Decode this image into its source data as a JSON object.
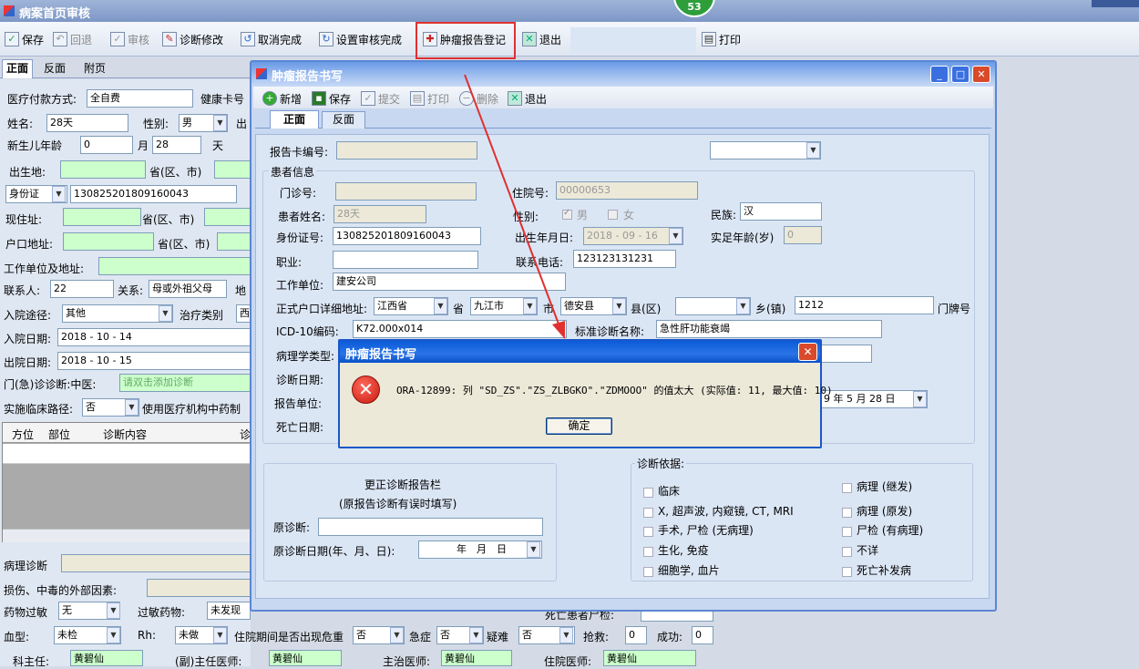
{
  "main_window": {
    "title": "病案首页审核",
    "badge": "53"
  },
  "toolbar": {
    "save": "保存",
    "rollback": "回退",
    "audit": "审核",
    "diag_edit": "诊断修改",
    "cancel_done": "取消完成",
    "set_done": "设置审核完成",
    "tumor_register": "肿瘤报告登记",
    "exit": "退出",
    "print": "打印"
  },
  "main_tabs": [
    "正面",
    "反面",
    "附页"
  ],
  "main_form": {
    "payment_label": "医疗付款方式:",
    "payment": "全自费",
    "health_card_label": "健康卡号",
    "name_label": "姓名:",
    "name": "28天",
    "gender_label": "性别:",
    "gender": "男",
    "birth_short": "出",
    "newborn_label": "新生儿年龄",
    "newborn_year": "0",
    "month": "月",
    "newborn_month": "28",
    "day": "天",
    "birthplace_label": "出生地:",
    "province_label": "省(区、市)",
    "id_type": "身份证",
    "id_number": "130825201809160043",
    "address_label": "现住址:",
    "hukou_label": "户口地址:",
    "work_label": "工作单位及地址:",
    "contact_label": "联系人:",
    "contact": "22",
    "relation_label": "关系:",
    "relation": "母或外祖父母",
    "land": "地",
    "admit_route_label": "入院途径:",
    "admit_route": "其他",
    "treat_type_label": "治疗类别",
    "treat_type": "西",
    "admit_date_label": "入院日期:",
    "admit_date": "2018 - 10 - 14",
    "discharge_date_label": "出院日期:",
    "discharge_date": "2018 - 10 - 15",
    "er_diag_label": "门(急)诊诊断:中医:",
    "er_diag_placeholder": "请双击添加诊断",
    "clinical_path_label": "实施临床路径:",
    "clinical_path": "否",
    "use_drug_label": "使用医疗机构中药制",
    "diag_table_headers": [
      "方位",
      "部位",
      "诊断内容",
      "诊"
    ],
    "pathology_label": "病理诊断",
    "injury_label": "损伤、中毒的外部因素:",
    "allergy_label": "药物过敏",
    "allergy": "无",
    "allergy_drug_label": "过敏药物:",
    "allergy_drug": "未发现",
    "blood_label": "血型:",
    "blood": "未检",
    "rh_label": "Rh:",
    "rh": "未做",
    "danger_label": "住院期间是否出现危重",
    "danger": "否",
    "acute_label": "急症",
    "acute": "否",
    "hard_label": "疑难",
    "hard": "否",
    "rescue_label": "抢救:",
    "rescue": "0",
    "success_label": "成功:",
    "success": "0",
    "director_label": "科主任:",
    "director": "黄碧仙",
    "vice_label": "(副)主任医师:",
    "vice": "黄碧仙",
    "attending_label": "主治医师:",
    "attending": "黄碧仙",
    "resident_label": "住院医师:",
    "resident": "黄碧仙",
    "death_age_label": "死亡患者尸检:"
  },
  "tumor_window": {
    "title": "肿瘤报告书写",
    "toolbar": {
      "add": "新增",
      "save": "保存",
      "submit": "提交",
      "print": "打印",
      "delete": "删除",
      "exit": "退出"
    },
    "tabs": [
      "正面",
      "反面"
    ],
    "card_no_label": "报告卡编号:",
    "patient_group": "患者信息",
    "outpatient_label": "门诊号:",
    "inpatient_label": "住院号:",
    "inpatient": "00000653",
    "pname_label": "患者姓名:",
    "pname": "28天",
    "gender_label": "性别:",
    "male": "男",
    "female": "女",
    "nation_label": "民族:",
    "nation": "汉",
    "idcard_label": "身份证号:",
    "idcard": "130825201809160043",
    "birthday_label": "出生年月日:",
    "birthday": "2018 - 09 - 16",
    "age_label": "实足年龄(岁)",
    "age": "0",
    "job_label": "职业:",
    "phone_label": "联系电话:",
    "phone": "123123131231",
    "work_label": "工作单位:",
    "work": "建安公司",
    "hukou_label": "正式户口详细地址:",
    "province": "江西省",
    "province_unit": "省",
    "city": "九江市",
    "city_unit": "市",
    "county": "德安县",
    "county_unit": "县(区)",
    "town_unit": "乡(镇)",
    "street": "1212",
    "door_label": "门牌号",
    "icd_label": "ICD-10编码:",
    "icd": "K72.000x014",
    "std_diag_label": "标准诊断名称:",
    "std_diag": "急性肝功能衰竭",
    "pathology_type_label": "病理学类型:",
    "diag_date_label": "诊断日期:",
    "report_unit_label": "报告单位:",
    "report_date": "9 年 5 月 28 日",
    "death_date_label": "死亡日期:",
    "correction_title": "更正诊断报告栏",
    "correction_sub": "(原报告诊断有误时填写)",
    "orig_diag_label": "原诊断:",
    "orig_date_label": "原诊断日期(年、月、日):",
    "orig_date": "年　月　日",
    "basis_label": "诊断依据:",
    "basis_left": [
      "临床",
      "X, 超声波, 内窥镜, CT, MRI",
      "手术, 尸检 (无病理)",
      "生化, 免疫",
      "细胞学, 血片"
    ],
    "basis_right": [
      "病理 (继发)",
      "病理 (原发)",
      "尸检 (有病理)",
      "不详",
      "死亡补发病"
    ]
  },
  "error_dialog": {
    "title": "肿瘤报告书写",
    "message": "ORA-12899: 列 \"SD_ZS\".\"ZS_ZLBGKO\".\"ZDMOOO\" 的值太大 (实际值: 11, 最大值: 10)",
    "ok": "确定"
  }
}
